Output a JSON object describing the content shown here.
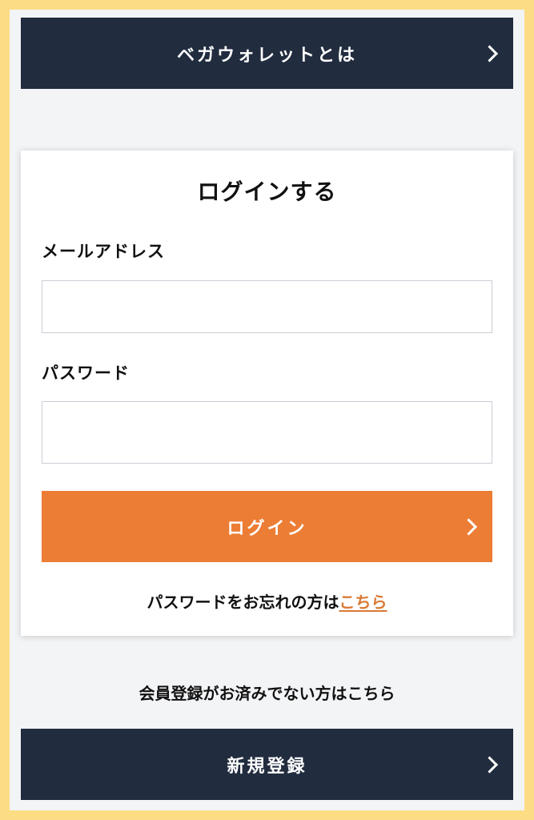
{
  "top_button": {
    "label": "ベガウォレットとは"
  },
  "login_card": {
    "title": "ログインする",
    "email": {
      "label": "メールアドレス",
      "value": "",
      "placeholder": ""
    },
    "password": {
      "label": "パスワード",
      "value": "",
      "placeholder": ""
    },
    "submit_label": "ログイン",
    "forgot_text": "パスワードをお忘れの方は",
    "forgot_link": "こちら"
  },
  "register": {
    "note": "会員登録がお済みでない方はこちら",
    "button_label": "新規登録"
  },
  "colors": {
    "page_border": "#fcdd84",
    "background": "#f3f4f6",
    "navy_button": "#212c3f",
    "accent_orange": "#ec7d35",
    "link": "#d87a36"
  },
  "icons": [
    "chevron-right-icon"
  ]
}
